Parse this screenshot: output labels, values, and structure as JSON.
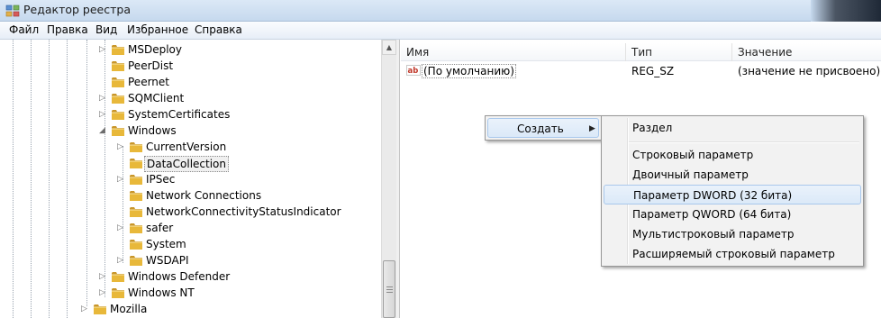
{
  "window": {
    "title": "Редактор реестра"
  },
  "menubar": [
    "Файл",
    "Правка",
    "Вид",
    "Избранное",
    "Справка"
  ],
  "tree": {
    "items": [
      {
        "label": "MSDeploy",
        "expander": "▷",
        "selected": false
      },
      {
        "label": "PeerDist",
        "expander": "",
        "selected": false
      },
      {
        "label": "Peernet",
        "expander": "",
        "selected": false
      },
      {
        "label": "SQMClient",
        "expander": "▷",
        "selected": false
      },
      {
        "label": "SystemCertificates",
        "expander": "▷",
        "selected": false
      },
      {
        "label": "Windows",
        "expander": "◢",
        "selected": false
      },
      {
        "label": "CurrentVersion",
        "expander": "▷",
        "selected": false
      },
      {
        "label": "DataCollection",
        "expander": "",
        "selected": true
      },
      {
        "label": "IPSec",
        "expander": "▷",
        "selected": false
      },
      {
        "label": "Network Connections",
        "expander": "",
        "selected": false
      },
      {
        "label": "NetworkConnectivityStatusIndicator",
        "expander": "",
        "selected": false
      },
      {
        "label": "safer",
        "expander": "▷",
        "selected": false
      },
      {
        "label": "System",
        "expander": "",
        "selected": false
      },
      {
        "label": "WSDAPI",
        "expander": "▷",
        "selected": false
      },
      {
        "label": "Windows Defender",
        "expander": "▷",
        "selected": false
      },
      {
        "label": "Windows NT",
        "expander": "▷",
        "selected": false
      },
      {
        "label": "Mozilla",
        "expander": "▷",
        "selected": false
      }
    ]
  },
  "values": {
    "headers": {
      "name": "Имя",
      "type": "Тип",
      "data": "Значение"
    },
    "rows": [
      {
        "icon": "string-value-icon",
        "name": "(По умолчанию)",
        "type": "REG_SZ",
        "data": "(значение не присвоено)"
      }
    ]
  },
  "context_menu": {
    "create": "Создать"
  },
  "submenu": {
    "items": [
      "Раздел",
      "Строковый параметр",
      "Двоичный параметр",
      "Параметр DWORD (32 бита)",
      "Параметр QWORD (64 бита)",
      "Мультистроковый параметр",
      "Расширяемый строковый параметр"
    ],
    "highlighted": "Параметр DWORD (32 бита)"
  },
  "colors": {
    "folder": "#e8b83a",
    "folder_dark": "#c9962a",
    "menu_bg": "#f2f2f2",
    "highlight_border": "#a9c8ec"
  }
}
